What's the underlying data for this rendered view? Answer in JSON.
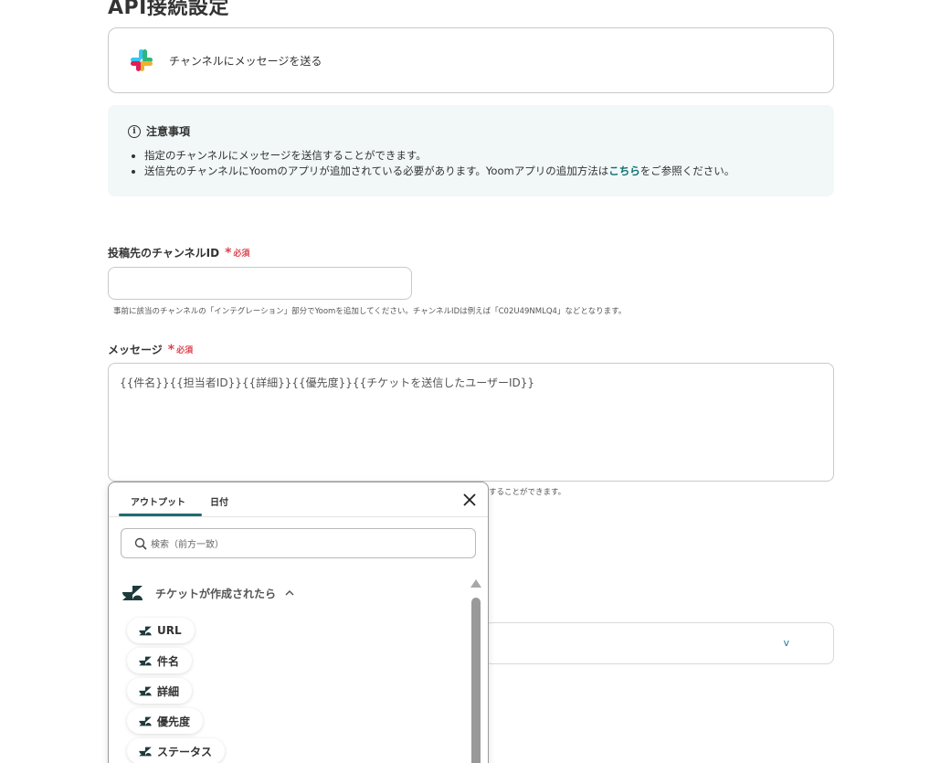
{
  "page": {
    "title": "API接続設定"
  },
  "action": {
    "label": "チャンネルにメッセージを送る"
  },
  "notice": {
    "heading": "注意事項",
    "item1": "指定のチャンネルにメッセージを送信することができます。",
    "item2_prefix": "送信先のチャンネルにYoomのアプリが追加されている必要があります。Yoomアプリの追加方法は",
    "item2_link": "こちら",
    "item2_suffix": "をご参照ください。"
  },
  "channel_field": {
    "label": "投稿先のチャンネルID",
    "required_mark": "*",
    "required_text": "必須",
    "value": "",
    "hint": "事前に該当のチャンネルの「インテグレーション」部分でYoomを追加してください。チャンネルIDは例えば「C02U49NMLQ4」などとなります。"
  },
  "message_field": {
    "label": "メッセージ",
    "required_mark": "*",
    "required_text": "必須",
    "value": "{{件名}}{{担当者ID}}{{詳細}}{{優先度}}{{チケットを送信したユーザーID}}",
    "hint_partial": "することができます。"
  },
  "select": {
    "caret": "v"
  },
  "popup": {
    "tabs": [
      {
        "label": "アウトプット"
      },
      {
        "label": "日付"
      }
    ],
    "search_placeholder": "検索（前方一致）",
    "group_title": "チケットが作成されたら",
    "group_chevron": "^",
    "items": [
      {
        "label": "URL"
      },
      {
        "label": "件名"
      },
      {
        "label": "詳細"
      },
      {
        "label": "優先度"
      },
      {
        "label": "ステータス"
      }
    ]
  },
  "colors": {
    "accent": "#1f6b73",
    "required": "#e0424e",
    "notice_bg": "#f1f8f7",
    "link": "#0f6e72"
  },
  "icons": {
    "app": "slack-icon",
    "trigger": "zendesk-icon",
    "close": "close-icon",
    "search": "search-icon",
    "info": "info-icon"
  }
}
